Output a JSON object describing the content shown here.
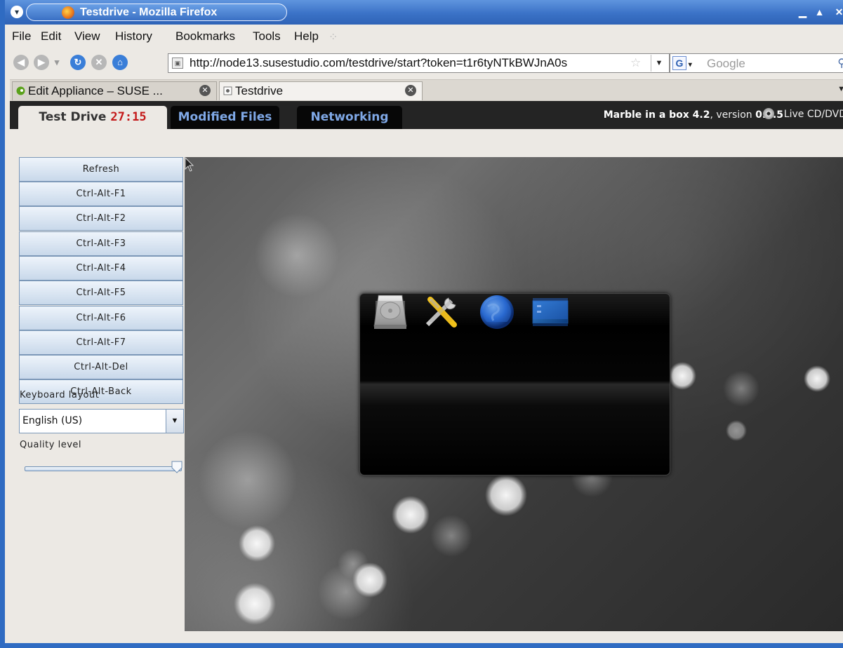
{
  "window": {
    "title": "Testdrive - Mozilla Firefox"
  },
  "menubar": {
    "items": [
      "File",
      "Edit",
      "View",
      "History",
      "Bookmarks",
      "Tools",
      "Help"
    ]
  },
  "navbar": {
    "url": "http://node13.susestudio.com/testdrive/start?token=t1r6tyNTkBWJnA0s",
    "search_engine": "G",
    "search_placeholder": "Google"
  },
  "tabs": [
    {
      "label": "Edit Appliance – SUSE ...",
      "favicon": "suse-icon"
    },
    {
      "label": "Testdrive",
      "favicon": "page-icon",
      "active": true
    }
  ],
  "testdrive": {
    "tabs": {
      "test_drive": "Test Drive",
      "timer": "27:15",
      "modified_files": "Modified Files",
      "networking": "Networking"
    },
    "appliance_name": "Marble in a box 4.2",
    "version_label": ", version ",
    "version": "0.0.5",
    "media_type": "Live CD/DVD",
    "colors": {
      "timer": "#c41a1a",
      "tab_link": "#7fa8e6",
      "header_bg": "#242424"
    }
  },
  "controls": {
    "buttons": [
      "Refresh",
      "Ctrl-Alt-F1",
      "Ctrl-Alt-F2",
      "Ctrl-Alt-F3",
      "Ctrl-Alt-F4",
      "Ctrl-Alt-F5",
      "Ctrl-Alt-F6",
      "Ctrl-Alt-F7",
      "Ctrl-Alt-Del",
      "Ctrl-Alt-Back"
    ],
    "keyboard_layout_label": "Keyboard layout",
    "keyboard_layout_value": "English (US)",
    "quality_label": "Quality level",
    "quality_value": 1.0
  },
  "splash": {
    "icons": [
      "hard-disk-icon",
      "tools-icon",
      "globe-icon",
      "desktop-icon"
    ]
  }
}
